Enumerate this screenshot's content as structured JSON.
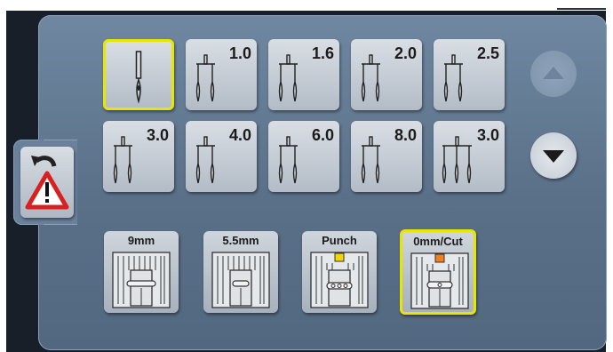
{
  "needles": [
    {
      "label": ""
    },
    {
      "label": "1.0"
    },
    {
      "label": "1.6"
    },
    {
      "label": "2.0"
    },
    {
      "label": "2.5"
    },
    {
      "label": "3.0"
    },
    {
      "label": "4.0"
    },
    {
      "label": "6.0"
    },
    {
      "label": "8.0"
    },
    {
      "label": "3.0"
    }
  ],
  "feet": [
    {
      "label": "9mm"
    },
    {
      "label": "5.5mm"
    },
    {
      "label": "Punch"
    },
    {
      "label": "0mm/Cut"
    }
  ],
  "icons": {
    "single_needle": "single-needle-icon",
    "double_needle": "twin-needle-icon",
    "triple_needle": "triple-needle-icon",
    "scroll_up": "scroll-up-arrow-icon",
    "scroll_down": "scroll-down-arrow-icon",
    "back_warning": "back-warning-icon",
    "stitch_plate": "stitch-plate-icon"
  },
  "colors": {
    "selected_border": "#e6e600",
    "foot_marker_yellow": "#f5d400",
    "foot_marker_orange": "#f08020",
    "warning_red": "#d92020"
  },
  "state": {
    "selected_needle": 0,
    "selected_foot": 3,
    "scroll_up_enabled": false,
    "scroll_down_enabled": true
  }
}
